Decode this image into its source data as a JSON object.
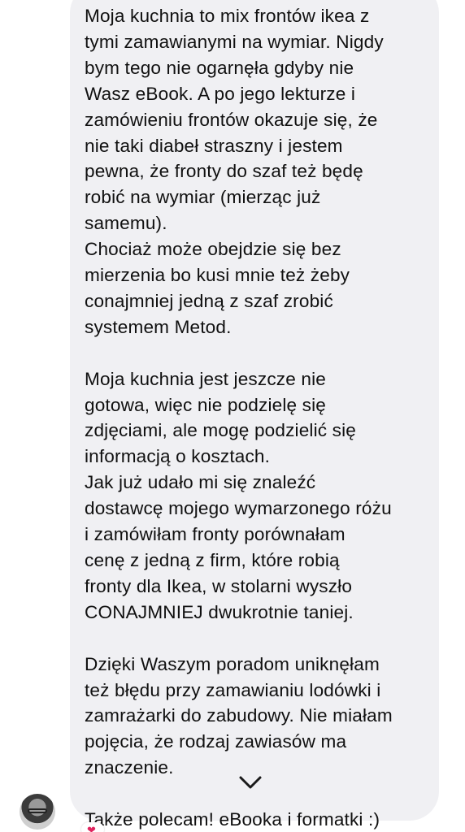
{
  "message": {
    "paragraph_1": "Moja kuchnia to mix frontów ikea z\ntymi zamawianymi na wymiar. Nigdy\nbym tego nie ogarnęła gdyby nie\nWasz eBook. A po jego lekturze i\nzamówieniu frontów okazuje się, że\nnie taki diabeł straszny i jestem\npewna, że fronty do szaf też będę\nrobić na wymiar (mierząc już\nsamemu).\nChociaż może obejdzie się bez\nmierzenia bo kusi mnie też żeby\nconajmniej jedną z szaf zrobić\nsystemem Metod.",
    "paragraph_2": "Moja kuchnia jest jeszcze nie\ngotowa, więc nie podzielę się\nzdjęciami, ale mogę podzielić się\ninformacją o kosztach.\nJak już udało mi się znaleźć\ndostawcę mojego wymarzonego różu\ni zamówiłam fronty porównałam\ncenę z jedną z firm, które robią\nfronty dla Ikea, w stolarni wyszło\nCONAJMNIEJ dwukrotnie taniej.",
    "paragraph_3": "Dzięki Waszym poradom uniknęłam\nteż błędu przy zamawianiu lodówki i\nzamrażarki do zabudowy. Nie miałam\npojęcia, że rodzaj zawiasów ma\nznaczenie.",
    "paragraph_4": "Także polecam! eBooka i formatki :)"
  },
  "icons": {
    "scroll_down": "chevron-down-icon",
    "reaction": "heart-icon",
    "avatar": "user-avatar"
  },
  "colors": {
    "bubble": "#f0f0f3",
    "text": "#101010",
    "reaction": "#e0245e"
  }
}
